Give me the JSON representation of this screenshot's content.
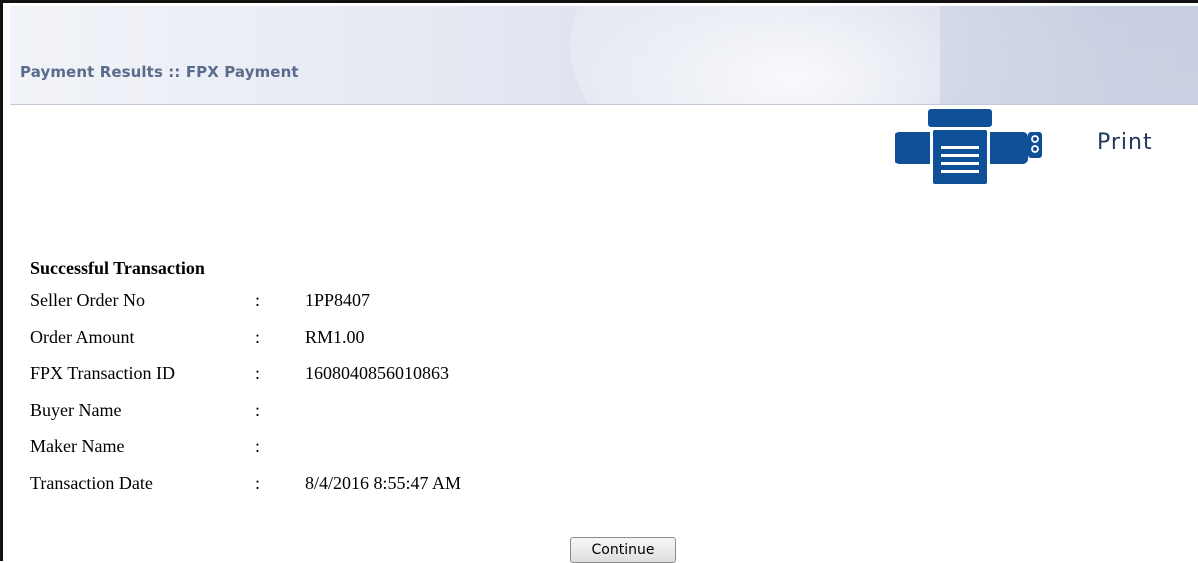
{
  "header": {
    "title": "Payment Results :: FPX Payment"
  },
  "print": {
    "label": "Print",
    "icon": "printer-icon",
    "color": "#0f4f97"
  },
  "result": {
    "title": "Successful Transaction",
    "fields": [
      {
        "label": "Seller Order No",
        "value": "1PP8407"
      },
      {
        "label": "Order Amount",
        "value": "RM1.00"
      },
      {
        "label": "FPX Transaction ID",
        "value": "1608040856010863"
      },
      {
        "label": "Buyer Name",
        "value": ""
      },
      {
        "label": "Maker Name",
        "value": ""
      },
      {
        "label": "Transaction Date",
        "value": "8/4/2016 8:55:47 AM"
      }
    ],
    "separator": ":"
  },
  "actions": {
    "continue_label": "Continue"
  }
}
